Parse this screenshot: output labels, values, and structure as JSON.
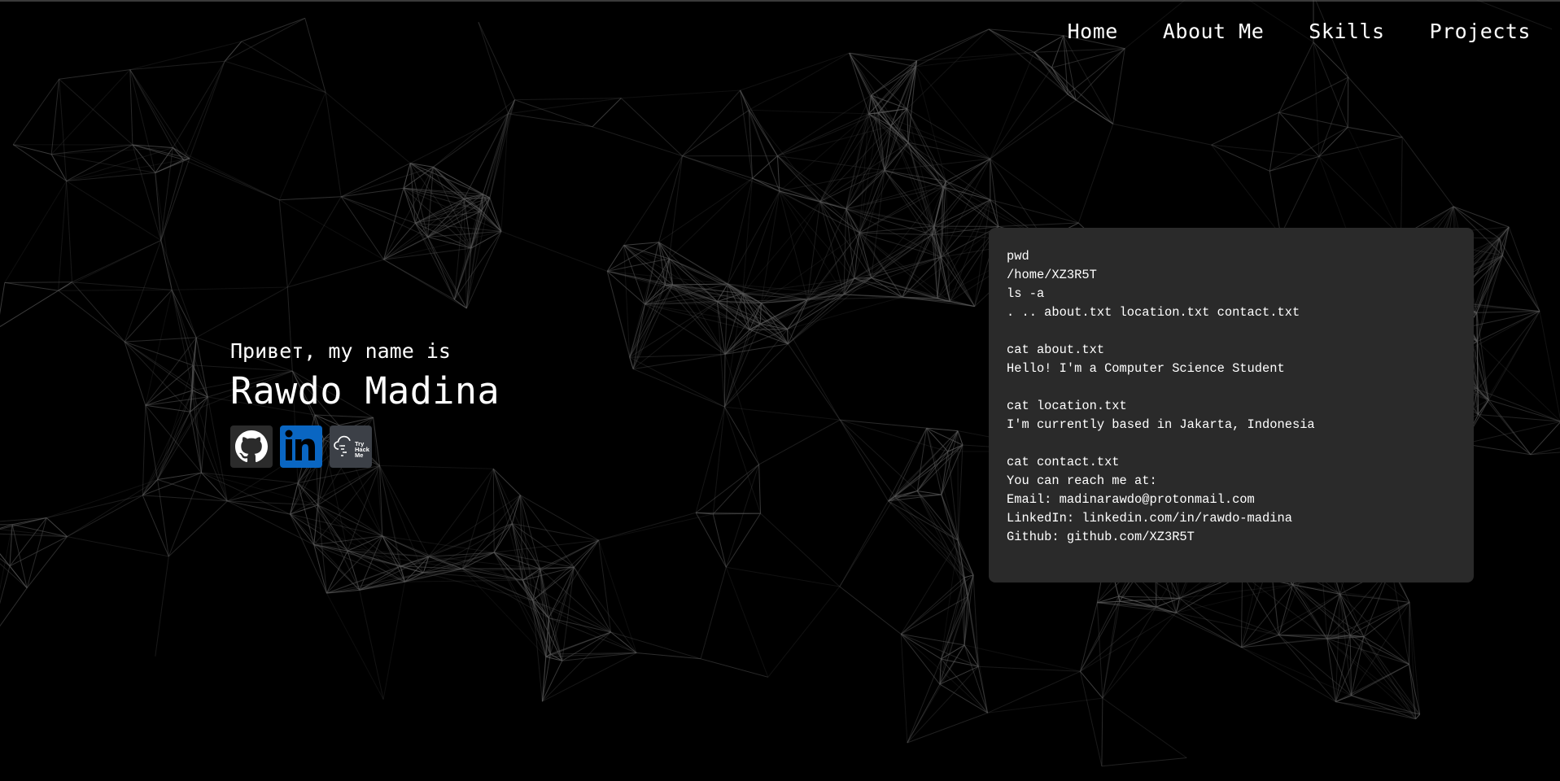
{
  "nav": {
    "items": [
      {
        "label": "Home"
      },
      {
        "label": "About Me"
      },
      {
        "label": "Skills"
      },
      {
        "label": "Projects"
      }
    ]
  },
  "intro": {
    "greeting": "Привет, my name is",
    "name": "Rawdo Madina"
  },
  "socials": {
    "github": {
      "icon": "github-icon"
    },
    "linkedin": {
      "icon": "linkedin-icon",
      "color": "#0a66c2"
    },
    "tryhackme": {
      "icon": "tryhackme-icon",
      "text": "Try Hack Me"
    }
  },
  "terminal": {
    "lines": [
      "pwd",
      "/home/XZ3R5T",
      "ls -a",
      ". .. about.txt location.txt contact.txt",
      "",
      "cat about.txt",
      "Hello! I'm a Computer Science Student",
      "",
      "cat location.txt",
      "I'm currently based in Jakarta, Indonesia",
      "",
      "cat contact.txt",
      "You can reach me at:",
      "Email: madinarawdo@protonmail.com",
      "LinkedIn: linkedin.com/in/rawdo-madina",
      "Github: github.com/XZ3R5T"
    ]
  },
  "colors": {
    "background": "#000000",
    "terminal_bg": "#2a2a2a",
    "network_lines": "#5a5a5a"
  }
}
